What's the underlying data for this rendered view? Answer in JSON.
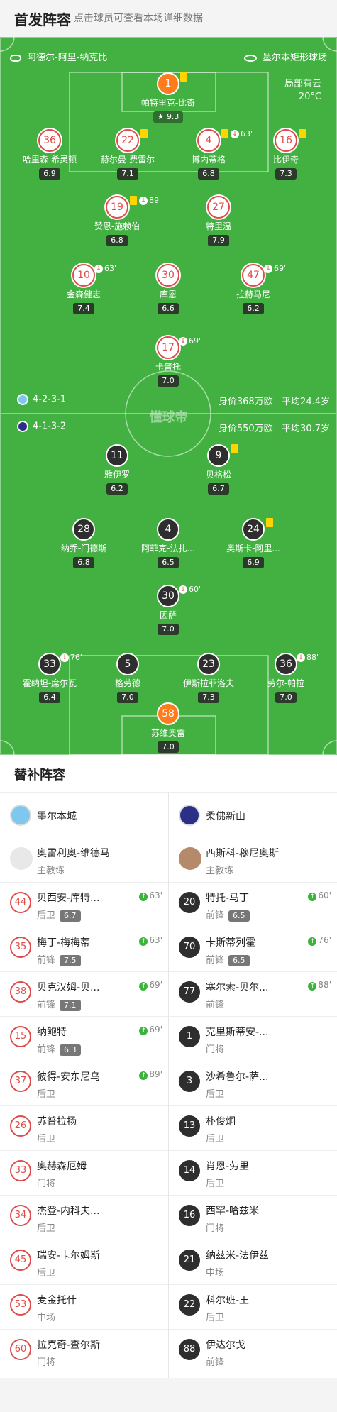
{
  "header": {
    "title": "首发阵容",
    "subtitle": "点击球员可查看本场详细数据"
  },
  "pitch": {
    "stadium": "阿德尔-阿里-纳克比",
    "venue": "墨尔本矩形球场",
    "weather": "局部有云",
    "temperature": "20°C",
    "watermark": "懂球帝",
    "home_formation": "4-2-3-1",
    "home_value": "身价368万欧",
    "home_age": "平均24.4岁",
    "away_formation": "4-1-3-2",
    "away_value": "身价550万欧",
    "away_age": "平均30.7岁"
  },
  "home_players": [
    {
      "num": "1",
      "name": "帕特里克-比奇",
      "rating": "9.3",
      "yellow": true,
      "star": true
    },
    {
      "num": "36",
      "name": "哈里森-希灵顿",
      "rating": "6.9"
    },
    {
      "num": "22",
      "name": "赫尔曼-费雷尔",
      "rating": "7.1",
      "yellow": true
    },
    {
      "num": "4",
      "name": "博内蒂格",
      "rating": "6.8",
      "yellow": true,
      "sub": "63'"
    },
    {
      "num": "16",
      "name": "比伊奇",
      "rating": "7.3",
      "yellow": true
    },
    {
      "num": "19",
      "name": "赞恩-施赖伯",
      "rating": "6.8",
      "yellow": true,
      "sub": "89'"
    },
    {
      "num": "27",
      "name": "特里温",
      "rating": "7.9"
    },
    {
      "num": "10",
      "name": "金森健志",
      "rating": "7.4",
      "sub": "63'"
    },
    {
      "num": "30",
      "name": "库恩",
      "rating": "6.6"
    },
    {
      "num": "47",
      "name": "拉赫马尼",
      "rating": "6.2",
      "sub": "69'"
    },
    {
      "num": "17",
      "name": "卡普托",
      "rating": "7.0",
      "sub": "69'"
    }
  ],
  "away_players": [
    {
      "num": "11",
      "name": "雅伊罗",
      "rating": "6.2"
    },
    {
      "num": "9",
      "name": "贝格松",
      "rating": "6.7",
      "yellow": true
    },
    {
      "num": "28",
      "name": "纳乔-门德斯",
      "rating": "6.8"
    },
    {
      "num": "4",
      "name": "阿菲克-法扎...",
      "rating": "6.5"
    },
    {
      "num": "24",
      "name": "奥斯卡-阿里...",
      "rating": "6.9",
      "yellow": true
    },
    {
      "num": "30",
      "name": "因萨",
      "rating": "7.0",
      "sub": "60'"
    },
    {
      "num": "33",
      "name": "霍纳坦-席尔瓦",
      "rating": "6.4",
      "sub": "76'"
    },
    {
      "num": "5",
      "name": "格劳德",
      "rating": "7.0"
    },
    {
      "num": "23",
      "name": "伊斯拉菲洛夫",
      "rating": "7.3"
    },
    {
      "num": "36",
      "name": "劳尔-帕拉",
      "rating": "7.0",
      "sub": "88'"
    },
    {
      "num": "58",
      "name": "苏维奥雷",
      "rating": "7.0"
    }
  ],
  "subs": {
    "title": "替补阵容",
    "home_team": "墨尔本城",
    "away_team": "柔佛新山",
    "home_coach": {
      "name": "奥雷利奥-维德马",
      "role": "主教练"
    },
    "away_coach": {
      "name": "西斯科-穆尼奥斯",
      "role": "主教练"
    },
    "home": [
      {
        "num": "44",
        "name": "贝西安-库特...",
        "pos": "后卫",
        "rating": "6.7",
        "ev": "63'"
      },
      {
        "num": "35",
        "name": "梅丁-梅梅蒂",
        "pos": "前锋",
        "rating": "7.5",
        "ev": "63'"
      },
      {
        "num": "38",
        "name": "贝克汉姆-贝...",
        "pos": "前锋",
        "rating": "7.1",
        "ev": "69'"
      },
      {
        "num": "15",
        "name": "纳鲍特",
        "pos": "前锋",
        "rating": "6.3",
        "ev": "69'"
      },
      {
        "num": "37",
        "name": "彼得-安东尼乌",
        "pos": "后卫",
        "rating": "",
        "ev": "89'"
      },
      {
        "num": "26",
        "name": "苏普拉扬",
        "pos": "后卫",
        "rating": "",
        "ev": ""
      },
      {
        "num": "33",
        "name": "奥赫森厄姆",
        "pos": "门将",
        "rating": "",
        "ev": ""
      },
      {
        "num": "34",
        "name": "杰登-内科夫...",
        "pos": "后卫",
        "rating": "",
        "ev": ""
      },
      {
        "num": "45",
        "name": "瑞安-卡尔姆斯",
        "pos": "后卫",
        "rating": "",
        "ev": ""
      },
      {
        "num": "53",
        "name": "麦金托什",
        "pos": "中场",
        "rating": "",
        "ev": ""
      },
      {
        "num": "60",
        "name": "拉克奇-查尔斯",
        "pos": "门将",
        "rating": "",
        "ev": ""
      }
    ],
    "away": [
      {
        "num": "20",
        "name": "特托-马丁",
        "pos": "前锋",
        "rating": "6.5",
        "ev": "60'"
      },
      {
        "num": "70",
        "name": "卡斯蒂列霍",
        "pos": "前锋",
        "rating": "6.5",
        "ev": "76'"
      },
      {
        "num": "77",
        "name": "塞尔索-贝尔...",
        "pos": "前锋",
        "rating": "",
        "ev": "88'"
      },
      {
        "num": "1",
        "name": "克里斯蒂安-...",
        "pos": "门将",
        "rating": "",
        "ev": ""
      },
      {
        "num": "3",
        "name": "沙希鲁尔-萨...",
        "pos": "后卫",
        "rating": "",
        "ev": ""
      },
      {
        "num": "13",
        "name": "朴俊炯",
        "pos": "后卫",
        "rating": "",
        "ev": ""
      },
      {
        "num": "14",
        "name": "肖恩-劳里",
        "pos": "后卫",
        "rating": "",
        "ev": ""
      },
      {
        "num": "16",
        "name": "西罕-哈兹米",
        "pos": "门将",
        "rating": "",
        "ev": ""
      },
      {
        "num": "21",
        "name": "纳兹米-法伊兹",
        "pos": "中场",
        "rating": "",
        "ev": ""
      },
      {
        "num": "22",
        "name": "科尔班-王",
        "pos": "后卫",
        "rating": "",
        "ev": ""
      },
      {
        "num": "88",
        "name": "伊达尔戈",
        "pos": "前锋",
        "rating": "",
        "ev": ""
      }
    ]
  },
  "colors": {
    "pitch": "#43b142",
    "home": "#e04b4b",
    "away": "#2e2e2e",
    "keeper": "#ff7b1c"
  }
}
